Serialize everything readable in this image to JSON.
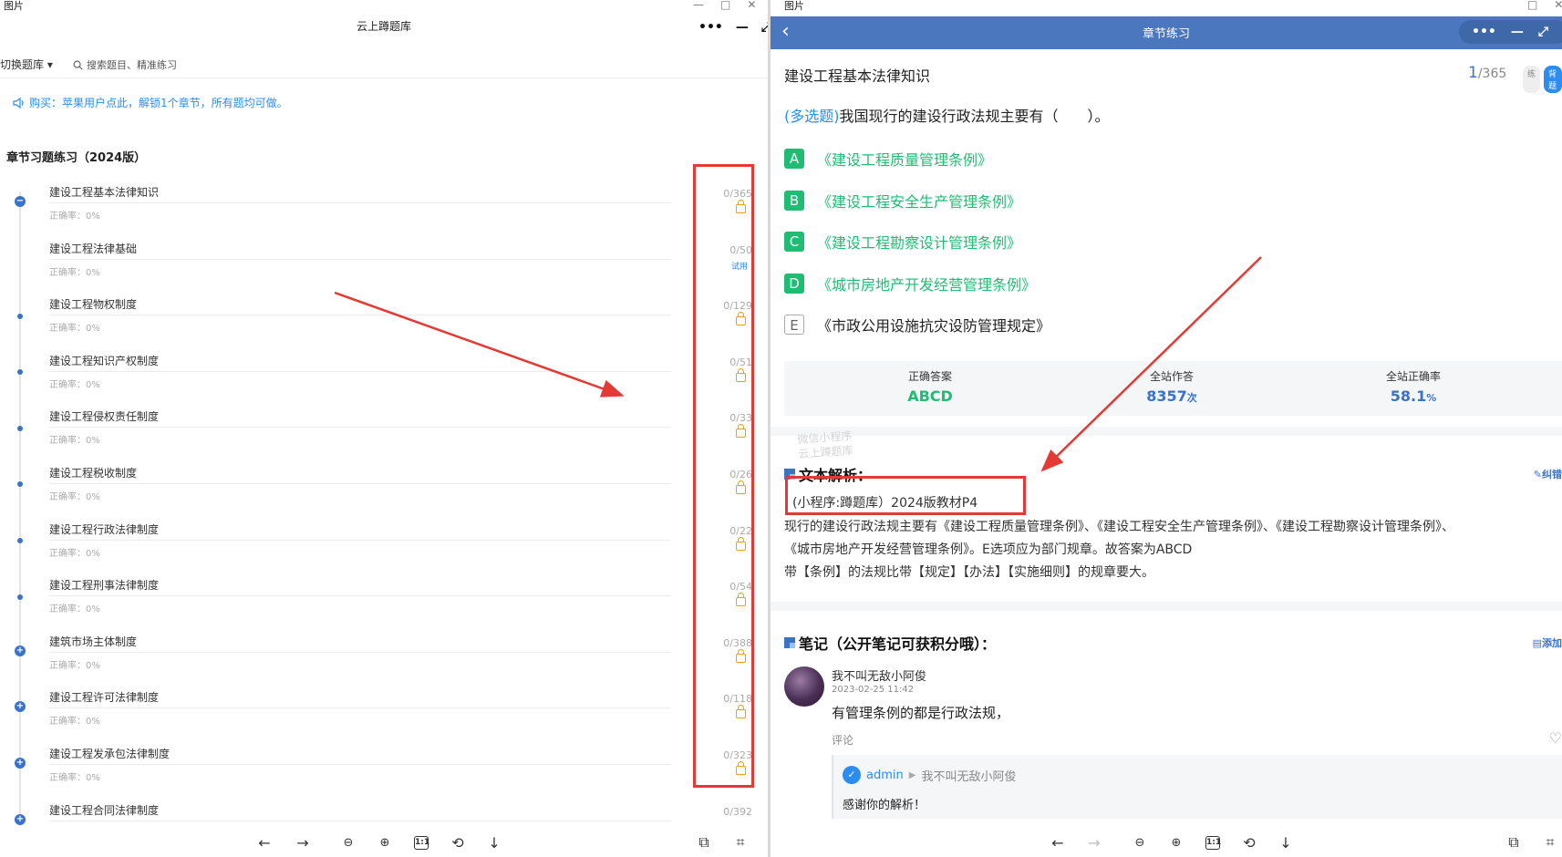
{
  "left": {
    "viewer_title": "图片",
    "app_title": "云上蹲题库",
    "switch_label": "切换题库",
    "search_placeholder": "搜索题目、精准练习",
    "notice": "购买：苹果用户点此，解锁1个章节，所有题均可做。",
    "section_title": "章节习题练习（2024版）",
    "chapters": [
      {
        "name": "建设工程基本法律知识",
        "accuracy": "正确率：0%",
        "count": "0/365",
        "badge": "lock",
        "dot": "minus"
      },
      {
        "name": "建设工程法律基础",
        "accuracy": "正确率：0%",
        "count": "0/50",
        "badge": "试用",
        "dot": "small"
      },
      {
        "name": "建设工程物权制度",
        "accuracy": "正确率：0%",
        "count": "0/129",
        "badge": "lock",
        "dot": "small"
      },
      {
        "name": "建设工程知识产权制度",
        "accuracy": "正确率：0%",
        "count": "0/51",
        "badge": "lock",
        "dot": "small"
      },
      {
        "name": "建设工程侵权责任制度",
        "accuracy": "正确率：0%",
        "count": "0/33",
        "badge": "lock",
        "dot": "small"
      },
      {
        "name": "建设工程税收制度",
        "accuracy": "正确率：0%",
        "count": "0/26",
        "badge": "lock",
        "dot": "small"
      },
      {
        "name": "建设工程行政法律制度",
        "accuracy": "正确率：0%",
        "count": "0/22",
        "badge": "lock",
        "dot": "small"
      },
      {
        "name": "建设工程刑事法律制度",
        "accuracy": "正确率：0%",
        "count": "0/54",
        "badge": "lock",
        "dot": "small"
      },
      {
        "name": "建筑市场主体制度",
        "accuracy": "正确率：0%",
        "count": "0/388",
        "badge": "lock",
        "dot": "plus"
      },
      {
        "name": "建设工程许可法律制度",
        "accuracy": "正确率：0%",
        "count": "0/118",
        "badge": "lock",
        "dot": "plus"
      },
      {
        "name": "建设工程发承包法律制度",
        "accuracy": "正确率：0%",
        "count": "0/323",
        "badge": "lock",
        "dot": "plus"
      },
      {
        "name": "建设工程合同法律制度",
        "accuracy": "",
        "count": "0/392",
        "badge": "",
        "dot": "plus"
      }
    ],
    "icons": {
      "notice": "speaker-icon",
      "search": "search-icon",
      "lock": "lock-icon"
    }
  },
  "right": {
    "viewer_title": "图片",
    "page_title": "章节练习",
    "chapter": "建设工程基本法律知识",
    "counter_current": "1",
    "counter_total": "/365",
    "mode_practice": "练",
    "mode_recite": "背题",
    "question_tag": "(多选题)",
    "question_text": "我国现行的建设行政法规主要有（　　）。",
    "options": [
      {
        "key": "A",
        "text": "《建设工程质量管理条例》",
        "correct": true
      },
      {
        "key": "B",
        "text": "《建设工程安全生产管理条例》",
        "correct": true
      },
      {
        "key": "C",
        "text": "《建设工程勘察设计管理条例》",
        "correct": true
      },
      {
        "key": "D",
        "text": "《城市房地产开发经营管理条例》",
        "correct": true
      },
      {
        "key": "E",
        "text": "《市政公用设施抗灾设防管理规定》",
        "correct": false
      }
    ],
    "stats": {
      "correct_label": "正确答案",
      "correct_value": "ABCD",
      "answered_label": "全站作答",
      "answered_value": "8357",
      "answered_unit": "次",
      "rate_label": "全站正确率",
      "rate_value": "58.1",
      "rate_unit": "%"
    },
    "watermark_line1": "微信小程序",
    "watermark_line2": "云上蹲题库",
    "analysis_title": "文本解析：",
    "analysis_action": "纠错",
    "analysis_source": "(小程序:蹲题库）2024版教材P4",
    "analysis_lines": [
      "现行的建设行政法规主要有《建设工程质量管理条例》、《建设工程安全生产管理条例》、《建设工程勘察设计管理条例》、",
      "《城市房地产开发经营管理条例》。E选项应为部门规章。故答案为ABCD",
      "带【条例】的法规比带【规定】【办法】【实施细则】的规章要大。"
    ],
    "notes_title": "笔记（公开笔记可获积分哦）：",
    "notes_action": "添加",
    "note": {
      "user": "我不叫无敌小阿俊",
      "time": "2023-02-25 11:42",
      "text": "有管理条例的都是行政法规，",
      "comment_label": "评论",
      "reply_user": "admin",
      "reply_to": "我不叫无敌小阿俊",
      "reply_text": "感谢你的解析！"
    }
  },
  "colors": {
    "brand_blue": "#4a77bd",
    "correct_green": "#1fbd74",
    "link_blue": "#2d8cf0",
    "annotation_red": "#e53935",
    "lock_orange": "#f0a000"
  }
}
